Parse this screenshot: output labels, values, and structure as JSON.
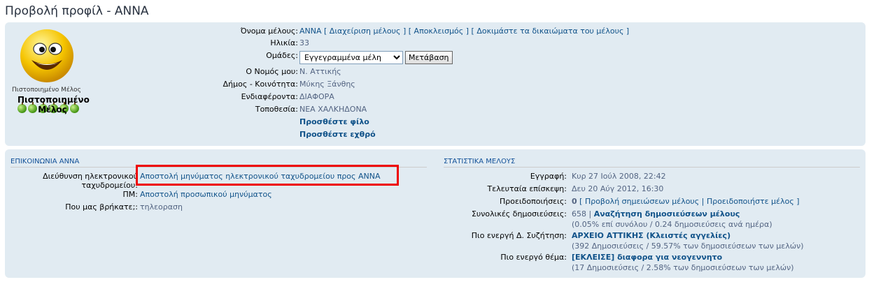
{
  "page_title": "Προβολή προφίλ - ANNA",
  "avatar": {
    "rank_label": "Πιστοποιημένο Μέλος",
    "rank_image_text": "Πιστοποιημένο Μέλος",
    "rank_image_icon": "apple-icon"
  },
  "profile": {
    "username_label": "Όνομα μέλους:",
    "username": "ANNA",
    "admin_links": [
      "[ Διαχείριση μέλους ]",
      "[ Αποκλεισμός ]",
      "[ Δοκιμάστε τα δικαιώματα του μέλους ]"
    ],
    "age_label": "Ηλικία:",
    "age": "33",
    "groups_label": "Ομάδες:",
    "groups_selected": "Εγγεγραμμένα μέλη",
    "go_button": "Μετάβαση",
    "nomos_label": "Ο Νομός μου:",
    "nomos": "Ν. Αττικής",
    "dimos_label": "Δήμος - Κοινότητα:",
    "dimos": "Μύκης Ξάνθης",
    "interests_label": "Ενδιαφέροντα:",
    "interests": "ΔΙΑΦΟΡΑ",
    "location_label": "Τοποθεσία:",
    "location": "ΝΕΑ ΧΑΛΚΗΔΟΝΑ",
    "add_friend": "Προσθέστε φίλο",
    "add_foe": "Προσθέστε εχθρό"
  },
  "contact": {
    "header": "ΕΠΙΚΟΙΝΩΝΙΑ ANNA",
    "email_label_1": "Διεύθυνση ηλεκτρονικού",
    "email_label_2": "ταχυδρομείου:",
    "email_link": "Αποστολή μηνύματος ηλεκτρονικού ταχυδρομείου προς ANNA",
    "pm_label": "ΠΜ:",
    "pm_link": "Αποστολή προσωπικού μηνύματος",
    "found_label": "Που μας βρήκατε;:",
    "found_value": "τηλεοραση",
    "highlight_color": "#e00000"
  },
  "stats": {
    "header": "ΣΤΑΤΙΣΤΙΚΑ ΜΕΛΟΥΣ",
    "joined_label": "Εγγραφή:",
    "joined": "Κυρ 27 Ιούλ 2008, 22:42",
    "last_visit_label": "Τελευταία επίσκεψη:",
    "last_visit": "Δευ 20 Αύγ 2012, 16:30",
    "warnings_label": "Προειδοποιήσεις:",
    "warnings_count": "0",
    "warnings_links": "[ Προβολή σημειώσεων μέλους | Προειδοποιήστε μέλος ]",
    "posts_label": "Συνολικές δημοσιεύσεις:",
    "posts_count": "658",
    "posts_sep": "|",
    "posts_search": "Αναζήτηση δημοσιεύσεων μέλους",
    "posts_pct": "(0.05% επί συνόλου / 0.24 δημοσιεύσεις ανά ημέρα)",
    "active_forum_label": "Πιο ενεργή Δ. Συζήτηση:",
    "active_forum": "ΑΡΧΕΙΟ ΑΤΤΙΚΗΣ (Κλειστές αγγελίες)",
    "active_forum_pct": "(392 Δημοσιεύσεις / 59.57% των δημοσιεύσεων των μελών)",
    "active_topic_label": "Πιο ενεργό θέμα:",
    "active_topic": "[ΕΚΛΕΙΣΕ] διαφορα για νεογεννητο",
    "active_topic_pct": "(17 Δημοσιεύσεις / 2.58% των δημοσιεύσεων των μελών)"
  }
}
